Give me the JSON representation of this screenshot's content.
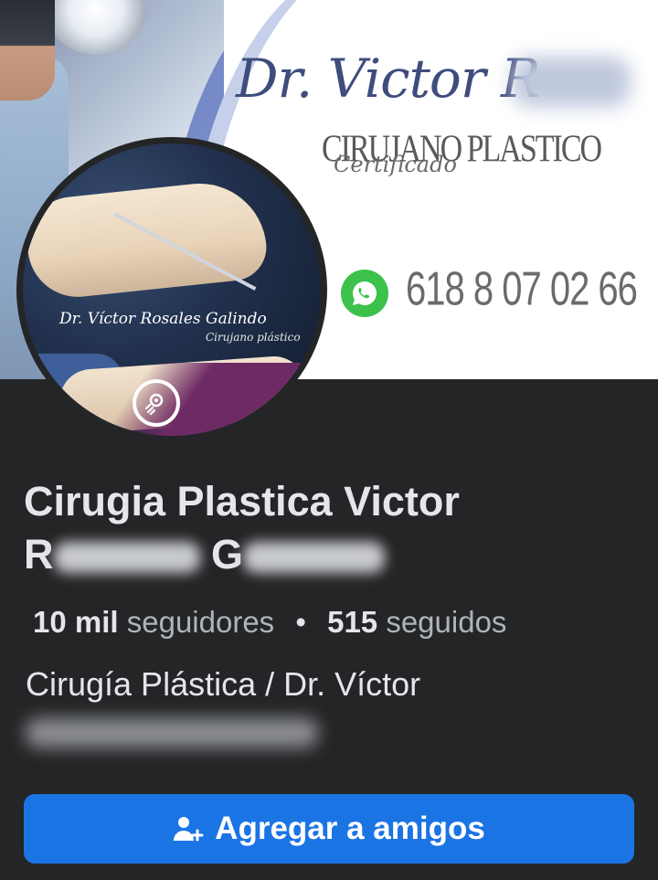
{
  "cover": {
    "name_text": "Dr. Victor R",
    "title_text": "CIRUJANO PLASTICO",
    "subtitle_text": "Certificado",
    "phone": "618 8 07 02 66",
    "whatsapp_icon": "whatsapp-icon",
    "accent_color": "#3f4d7d"
  },
  "avatar": {
    "caption": "Dr. Víctor Rosales Galindo",
    "subcaption": "Cirujano plástico",
    "badge_icon": "professional-mode-icon",
    "frame_color": "#6e2a64"
  },
  "profile": {
    "name_line1": "Cirugia Plastica Victor",
    "name_initial_1": "R",
    "name_initial_2": "G",
    "followers_count": "10 mil",
    "followers_label": "seguidores",
    "separator": "•",
    "following_count": "515",
    "following_label": "seguidos",
    "category": "Cirugía Plástica / Dr. Víctor"
  },
  "actions": {
    "add_friend_label": "Agregar a amigos",
    "add_friend_icon": "add-friend-icon",
    "button_color": "#1b74e4"
  }
}
